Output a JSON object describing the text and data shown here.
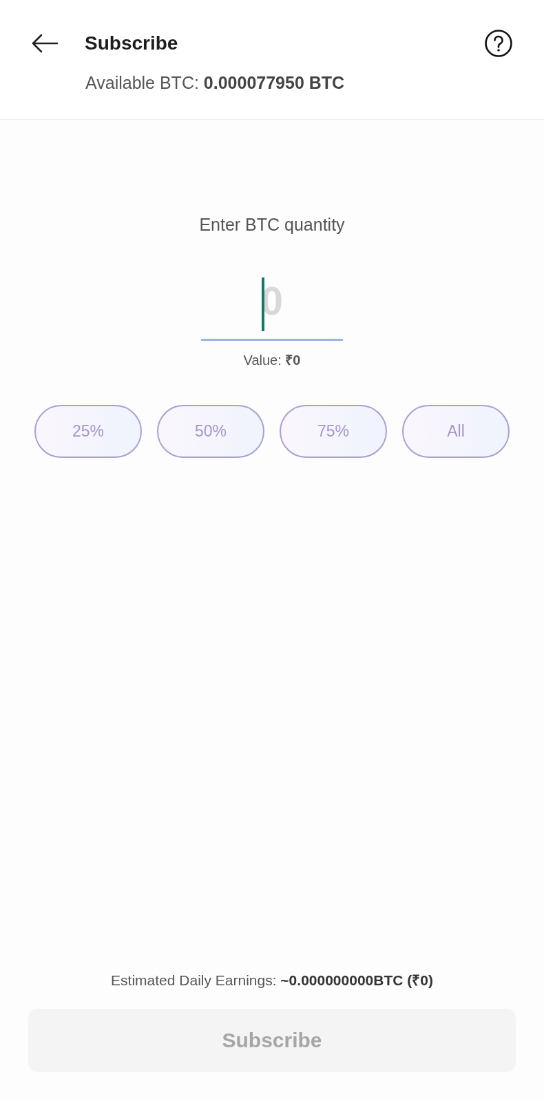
{
  "header": {
    "title": "Subscribe",
    "available": "Available BTC: **0.000077950 BTC**"
  },
  "quantity": {
    "label": "Enter BTC quantity",
    "placeholder": "0",
    "value_text": "Value: **₹0**"
  },
  "presets": [
    "25%",
    "50%",
    "75%",
    "All"
  ],
  "estimate": "Estimated Daily Earnings: **~0.000000000BTC (₹0)**",
  "subscribe_button": {
    "label": "Subscribe",
    "disabled": true
  }
}
